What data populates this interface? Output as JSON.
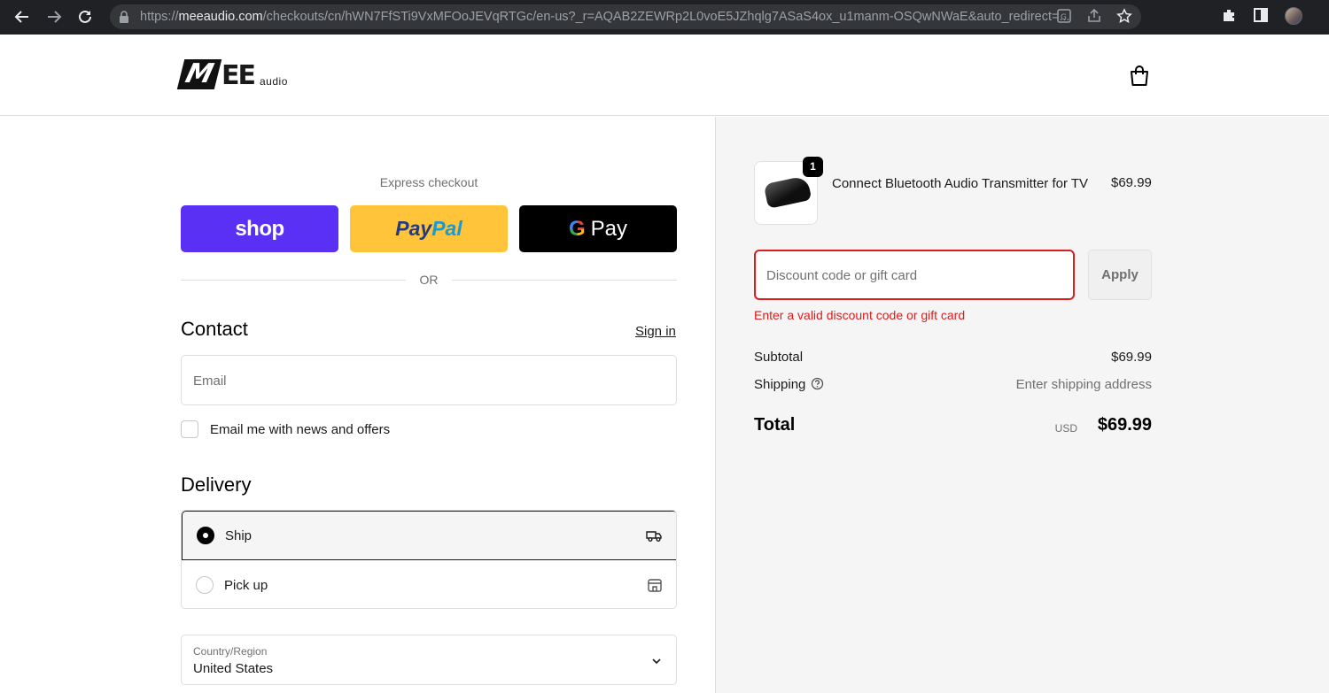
{
  "browser": {
    "url_prefix": "https://",
    "url_host": "meeaudio.com",
    "url_rest": "/checkouts/cn/hWN7FfSTi9VxMFOoJEVqRTGc/en-us?_r=AQAB2ZEWRp2L0voE5JZhqlg7ASaS4ox_u1manm-OSQwNWaE&auto_redirect=...",
    "icons": [
      "back-icon",
      "forward-icon",
      "reload-icon",
      "lock-icon",
      "translate-icon",
      "share-icon",
      "star-icon",
      "extensions-icon",
      "sidepanel-icon",
      "profile-avatar"
    ]
  },
  "header": {
    "logo_m": "M",
    "logo_ee": "EE",
    "logo_audio": "audio",
    "cart_icon": "shopping-bag-icon"
  },
  "express": {
    "label": "Express checkout",
    "shop_label": "shop",
    "paypal_part1": "Pay",
    "paypal_part2": "Pal",
    "gpay_g": "G",
    "gpay_label": "Pay",
    "or_label": "OR"
  },
  "contact": {
    "heading": "Contact",
    "signin_label": "Sign in",
    "email_placeholder": "Email",
    "newsletter_label": "Email me with news and offers"
  },
  "delivery": {
    "heading": "Delivery",
    "options": [
      {
        "label": "Ship",
        "selected": true,
        "icon": "truck-icon"
      },
      {
        "label": "Pick up",
        "selected": false,
        "icon": "store-icon"
      }
    ],
    "country_label": "Country/Region",
    "country_value": "United States"
  },
  "summary": {
    "item": {
      "quantity": "1",
      "name": "Connect Bluetooth Audio Transmitter for TV",
      "price": "$69.99"
    },
    "discount_placeholder": "Discount code or gift card",
    "apply_label": "Apply",
    "error_text": "Enter a valid discount code or gift card",
    "subtotal_label": "Subtotal",
    "subtotal_value": "$69.99",
    "shipping_label": "Shipping",
    "shipping_value": "Enter shipping address",
    "total_label": "Total",
    "currency": "USD",
    "total_value": "$69.99"
  },
  "colors": {
    "shop_purple": "#5a31f4",
    "paypal_yellow": "#ffc439",
    "error_red": "#dd1d1d"
  }
}
